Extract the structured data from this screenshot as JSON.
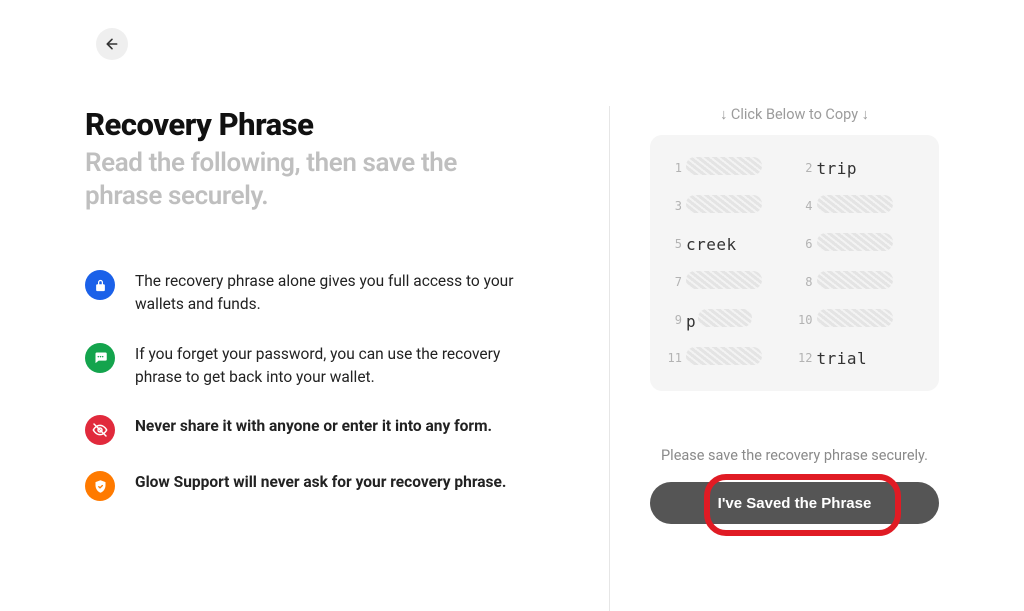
{
  "header": {
    "title": "Recovery Phrase",
    "subtitle": "Read the following, then save the phrase securely."
  },
  "bullets": [
    {
      "icon": "lock-icon",
      "color": "blue",
      "text": "The recovery phrase alone gives you full access to your wallets and funds.",
      "bold": false
    },
    {
      "icon": "message-icon",
      "color": "green",
      "text": "If you forget your password, you can use the recovery phrase to get back into your wallet.",
      "bold": false
    },
    {
      "icon": "eye-off-icon",
      "color": "red",
      "text": "Never share it with anyone or enter it into any form.",
      "bold": true
    },
    {
      "icon": "shield-icon",
      "color": "orange",
      "text": "Glow Support will never ask for your recovery phrase.",
      "bold": true
    }
  ],
  "phrase": {
    "copy_hint": "↓ Click Below to Copy ↓",
    "words": [
      {
        "n": 1,
        "word": "",
        "hidden": true
      },
      {
        "n": 2,
        "word": "trip",
        "hidden": false
      },
      {
        "n": 3,
        "word": "",
        "hidden": true
      },
      {
        "n": 4,
        "word": "",
        "hidden": true
      },
      {
        "n": 5,
        "word": "creek",
        "hidden": false
      },
      {
        "n": 6,
        "word": "",
        "hidden": true
      },
      {
        "n": 7,
        "word": "",
        "hidden": true
      },
      {
        "n": 8,
        "word": "",
        "hidden": true
      },
      {
        "n": 9,
        "word": "",
        "hidden": true
      },
      {
        "n": 10,
        "word": "",
        "hidden": true
      },
      {
        "n": 11,
        "word": "",
        "hidden": true
      },
      {
        "n": 12,
        "word": "trial",
        "hidden": false
      }
    ]
  },
  "footer": {
    "save_hint": "Please save the recovery phrase securely.",
    "save_button": "I've Saved the Phrase"
  }
}
